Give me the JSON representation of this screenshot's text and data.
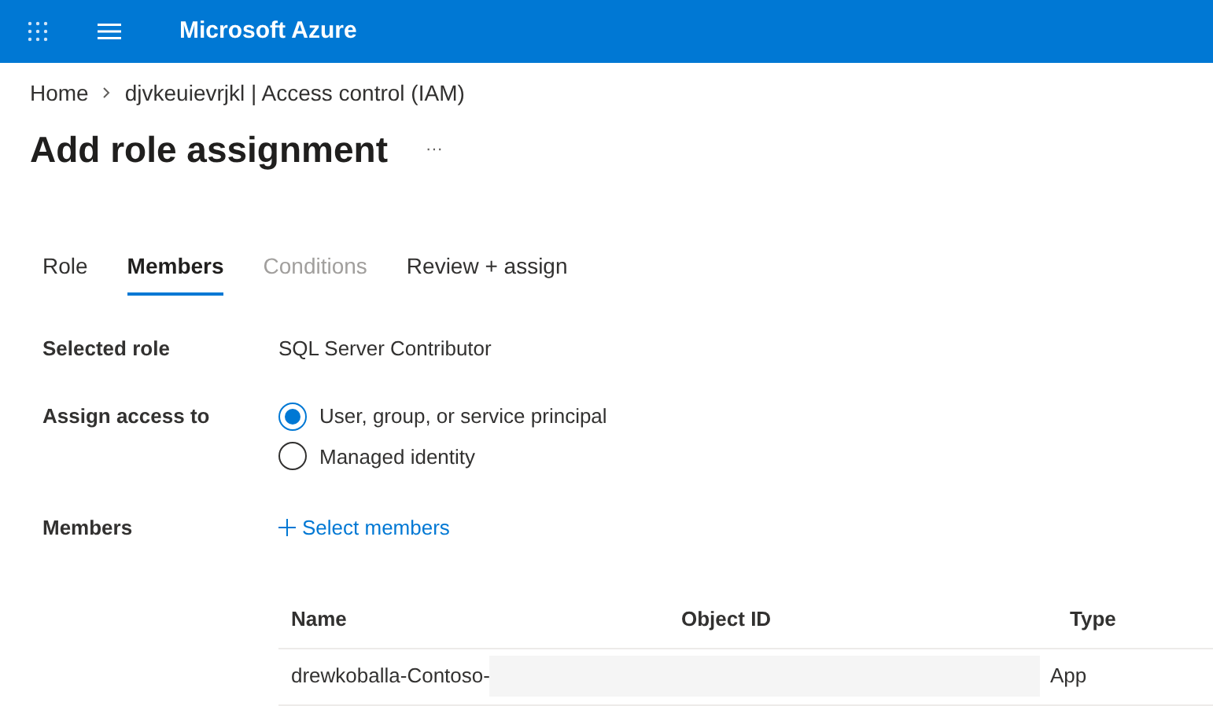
{
  "header": {
    "title": "Microsoft Azure"
  },
  "breadcrumb": [
    "Home",
    "djvkeuievrjkl | Access control (IAM)"
  ],
  "page_title": "Add role assignment",
  "more": "···",
  "tabs": [
    {
      "label": "Role",
      "selected": false,
      "disabled": false
    },
    {
      "label": "Members",
      "selected": true,
      "disabled": false
    },
    {
      "label": "Conditions",
      "selected": false,
      "disabled": true
    },
    {
      "label": "Review + assign",
      "selected": false,
      "disabled": false
    }
  ],
  "selected_role": {
    "label": "Selected role",
    "value": "SQL Server Contributor"
  },
  "assign_access": {
    "label": "Assign access to",
    "options": [
      {
        "label": "User, group, or service principal",
        "selected": true
      },
      {
        "label": "Managed identity",
        "selected": false
      }
    ]
  },
  "members": {
    "label": "Members",
    "link": "Select members"
  },
  "table": {
    "columns": [
      "Name",
      "Object ID",
      "Type"
    ],
    "rows": [
      [
        "drewkoballa-Contoso-",
        "",
        "App"
      ]
    ]
  }
}
